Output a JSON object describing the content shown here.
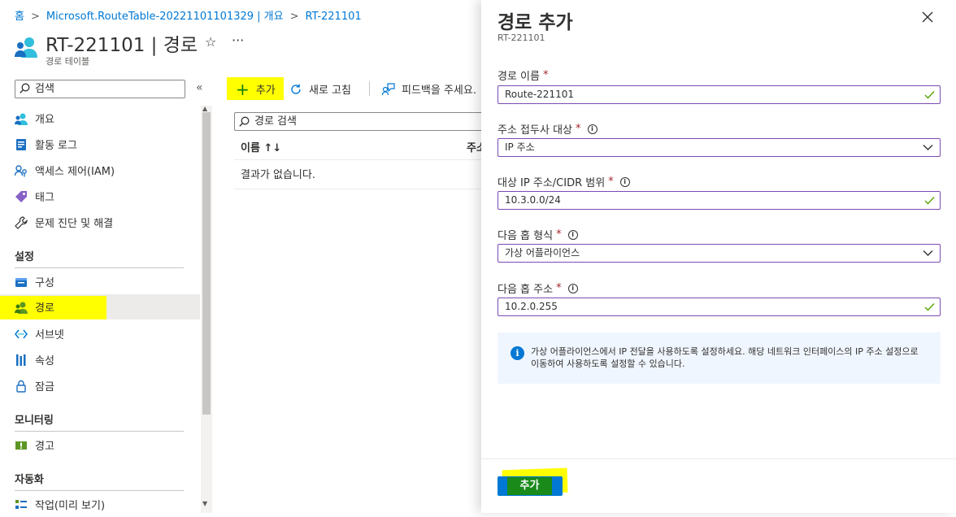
{
  "breadcrumb": {
    "items": [
      "홈",
      "Microsoft.RouteTable-20221101101329 | 개요",
      "RT-221101"
    ],
    "separator": ">"
  },
  "header": {
    "title": "RT-221101 | 경로",
    "subtitle": "경로 테이블",
    "favorite_icon": "star-icon",
    "more_icon": "ellipsis-icon"
  },
  "sidebar": {
    "search_placeholder": "검색",
    "collapse_label": "«",
    "items": [
      {
        "label": "개요",
        "icon": "overview-icon"
      },
      {
        "label": "활동 로그",
        "icon": "activity-log-icon"
      },
      {
        "label": "액세스 제어(IAM)",
        "icon": "iam-icon"
      },
      {
        "label": "태그",
        "icon": "tag-icon"
      },
      {
        "label": "문제 진단 및 해결",
        "icon": "wrench-icon"
      }
    ],
    "section_settings": "설정",
    "settings_items": [
      {
        "label": "구성",
        "icon": "configuration-icon"
      },
      {
        "label": "경로",
        "icon": "route-icon",
        "active": true
      },
      {
        "label": "서브넷",
        "icon": "subnet-icon"
      },
      {
        "label": "속성",
        "icon": "properties-icon"
      },
      {
        "label": "잠금",
        "icon": "lock-icon"
      }
    ],
    "section_monitoring": "모니터링",
    "monitoring_items": [
      {
        "label": "경고",
        "icon": "alert-icon"
      }
    ],
    "section_automation": "자동화",
    "automation_items": [
      {
        "label": "작업(미리 보기)",
        "icon": "tasks-icon"
      }
    ]
  },
  "toolbar": {
    "add_label": "추가",
    "refresh_label": "새로 고침",
    "feedback_label": "피드백을 주세요."
  },
  "grid": {
    "search_placeholder": "경로 검색",
    "columns": [
      "이름 ↑↓",
      "주소"
    ],
    "empty_text": "결과가 없습니다."
  },
  "panel": {
    "title": "경로 추가",
    "subtitle": "RT-221101",
    "close_icon": "close-icon",
    "fields": {
      "route_name": {
        "label": "경로 이름",
        "value": "Route-221101",
        "required": true
      },
      "destination_type": {
        "label": "주소 접두사 대상",
        "value": "IP 주소",
        "required": true
      },
      "destination_range": {
        "label": "대상 IP 주소/CIDR 범위",
        "value": "10.3.0.0/24",
        "required": true
      },
      "next_hop_type": {
        "label": "다음 홉 형식",
        "value": "가상 어플라이언스",
        "required": true
      },
      "next_hop_address": {
        "label": "다음 홉 주소",
        "value": "10.2.0.255",
        "required": true
      }
    },
    "required_mark": "*",
    "info_mark": "i",
    "info_text": "가상 어플라이언스에서 IP 전달을 사용하도록 설정하세요. 해당 네트워크 인터페이스의 IP 주소 설정으로 이동하여 사용하도록 설정할 수 있습니다.",
    "add_button": "추가"
  },
  "colors": {
    "accent": "#0078d4",
    "highlight": "#ffff00",
    "valid_check": "#57a300",
    "field_border": "#7a4bb3"
  }
}
